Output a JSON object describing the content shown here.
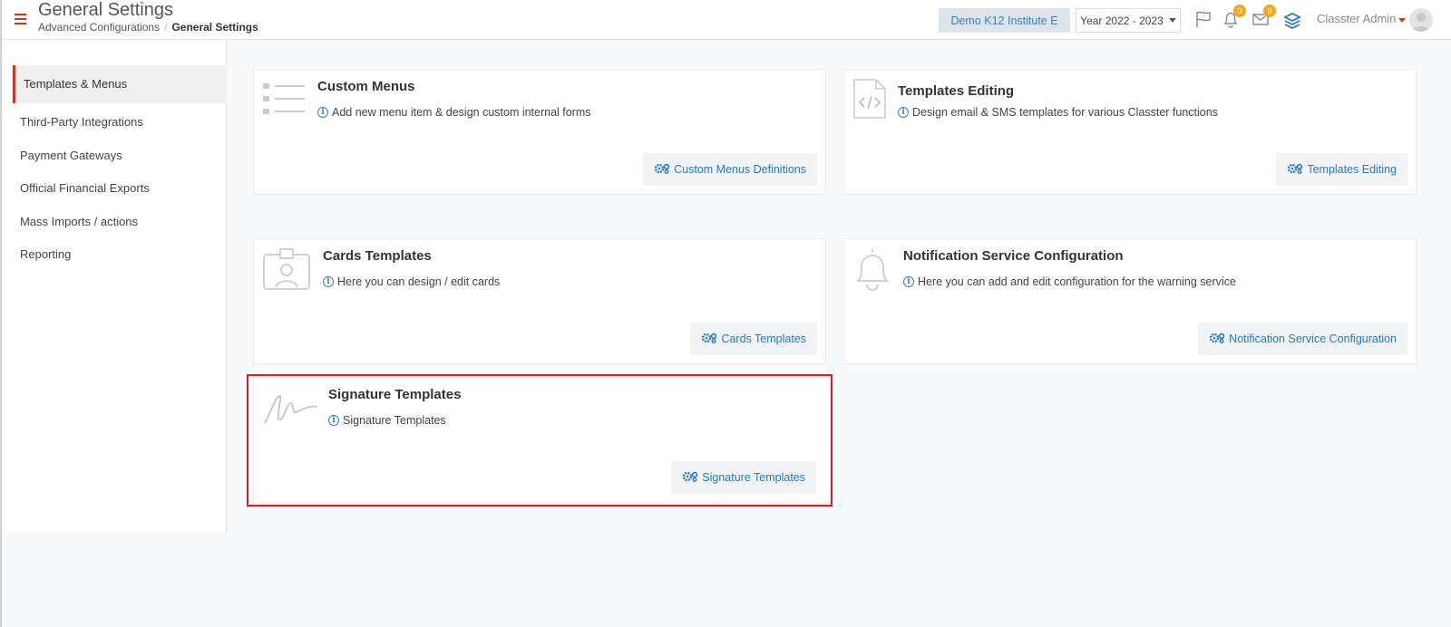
{
  "header": {
    "title": "General Settings",
    "breadcrumb": {
      "parent": "Advanced Configurations",
      "separator": "/",
      "current": "General Settings"
    },
    "institute": "Demo K12 Institute E",
    "year": "Year 2022 - 2023",
    "notifications_count": "0",
    "messages_count": "0",
    "user_name": "Classter Admin"
  },
  "sidebar": {
    "items": [
      {
        "label": "Templates & Menus",
        "active": true
      },
      {
        "label": "Third-Party Integrations"
      },
      {
        "label": "Payment Gateways"
      },
      {
        "label": "Official Financial Exports"
      },
      {
        "label": "Mass Imports / actions"
      },
      {
        "label": "Reporting"
      }
    ]
  },
  "cards": [
    {
      "title": "Custom Menus",
      "description": "Add new menu item & design custom internal forms",
      "button": "Custom Menus Definitions",
      "icon": "list-icon"
    },
    {
      "title": "Templates Editing",
      "description": "Design email & SMS templates for various Classter functions",
      "button": "Templates Editing",
      "icon": "code-file-icon"
    },
    {
      "title": "Cards Templates",
      "description": "Here you can design / edit cards",
      "button": "Cards Templates",
      "icon": "id-badge-icon"
    },
    {
      "title": "Notification Service Configuration",
      "description": "Here you can add and edit configuration for the warning service",
      "button": "Notification Service Configuration",
      "icon": "bell-icon"
    },
    {
      "title": "Signature Templates",
      "description": "Signature Templates",
      "button": "Signature Templates",
      "icon": "signature-icon"
    }
  ],
  "colors": {
    "accent": "#c0392b",
    "link": "#2a7ab8",
    "badge": "#f5a623",
    "highlight": "#e01b24"
  }
}
